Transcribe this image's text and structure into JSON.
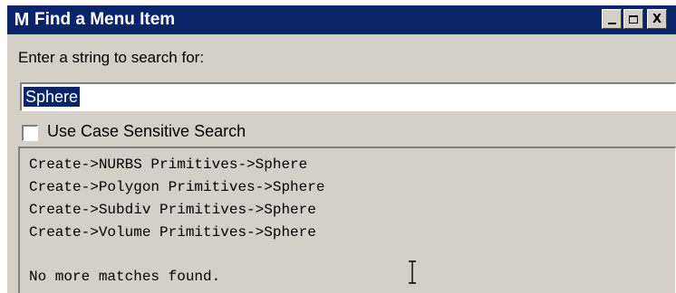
{
  "window": {
    "title": "Find a Menu Item",
    "app_icon": "maya-icon",
    "controls": {
      "minimize": "minimize-icon",
      "maximize": "maximize-icon",
      "close_label": "X"
    }
  },
  "search": {
    "prompt": "Enter a string to search for:",
    "value": "Sphere"
  },
  "case_sensitive": {
    "label": "Use Case Sensitive Search",
    "checked": false
  },
  "results": {
    "items": [
      "Create->NURBS Primitives->Sphere",
      "Create->Polygon Primitives->Sphere",
      "Create->Subdiv Primitives->Sphere",
      "Create->Volume Primitives->Sphere"
    ],
    "status": "No more matches found."
  },
  "colors": {
    "titlebar": "#0a246a",
    "dialog_face": "#d4d0c8",
    "selection": "#0a246a"
  }
}
